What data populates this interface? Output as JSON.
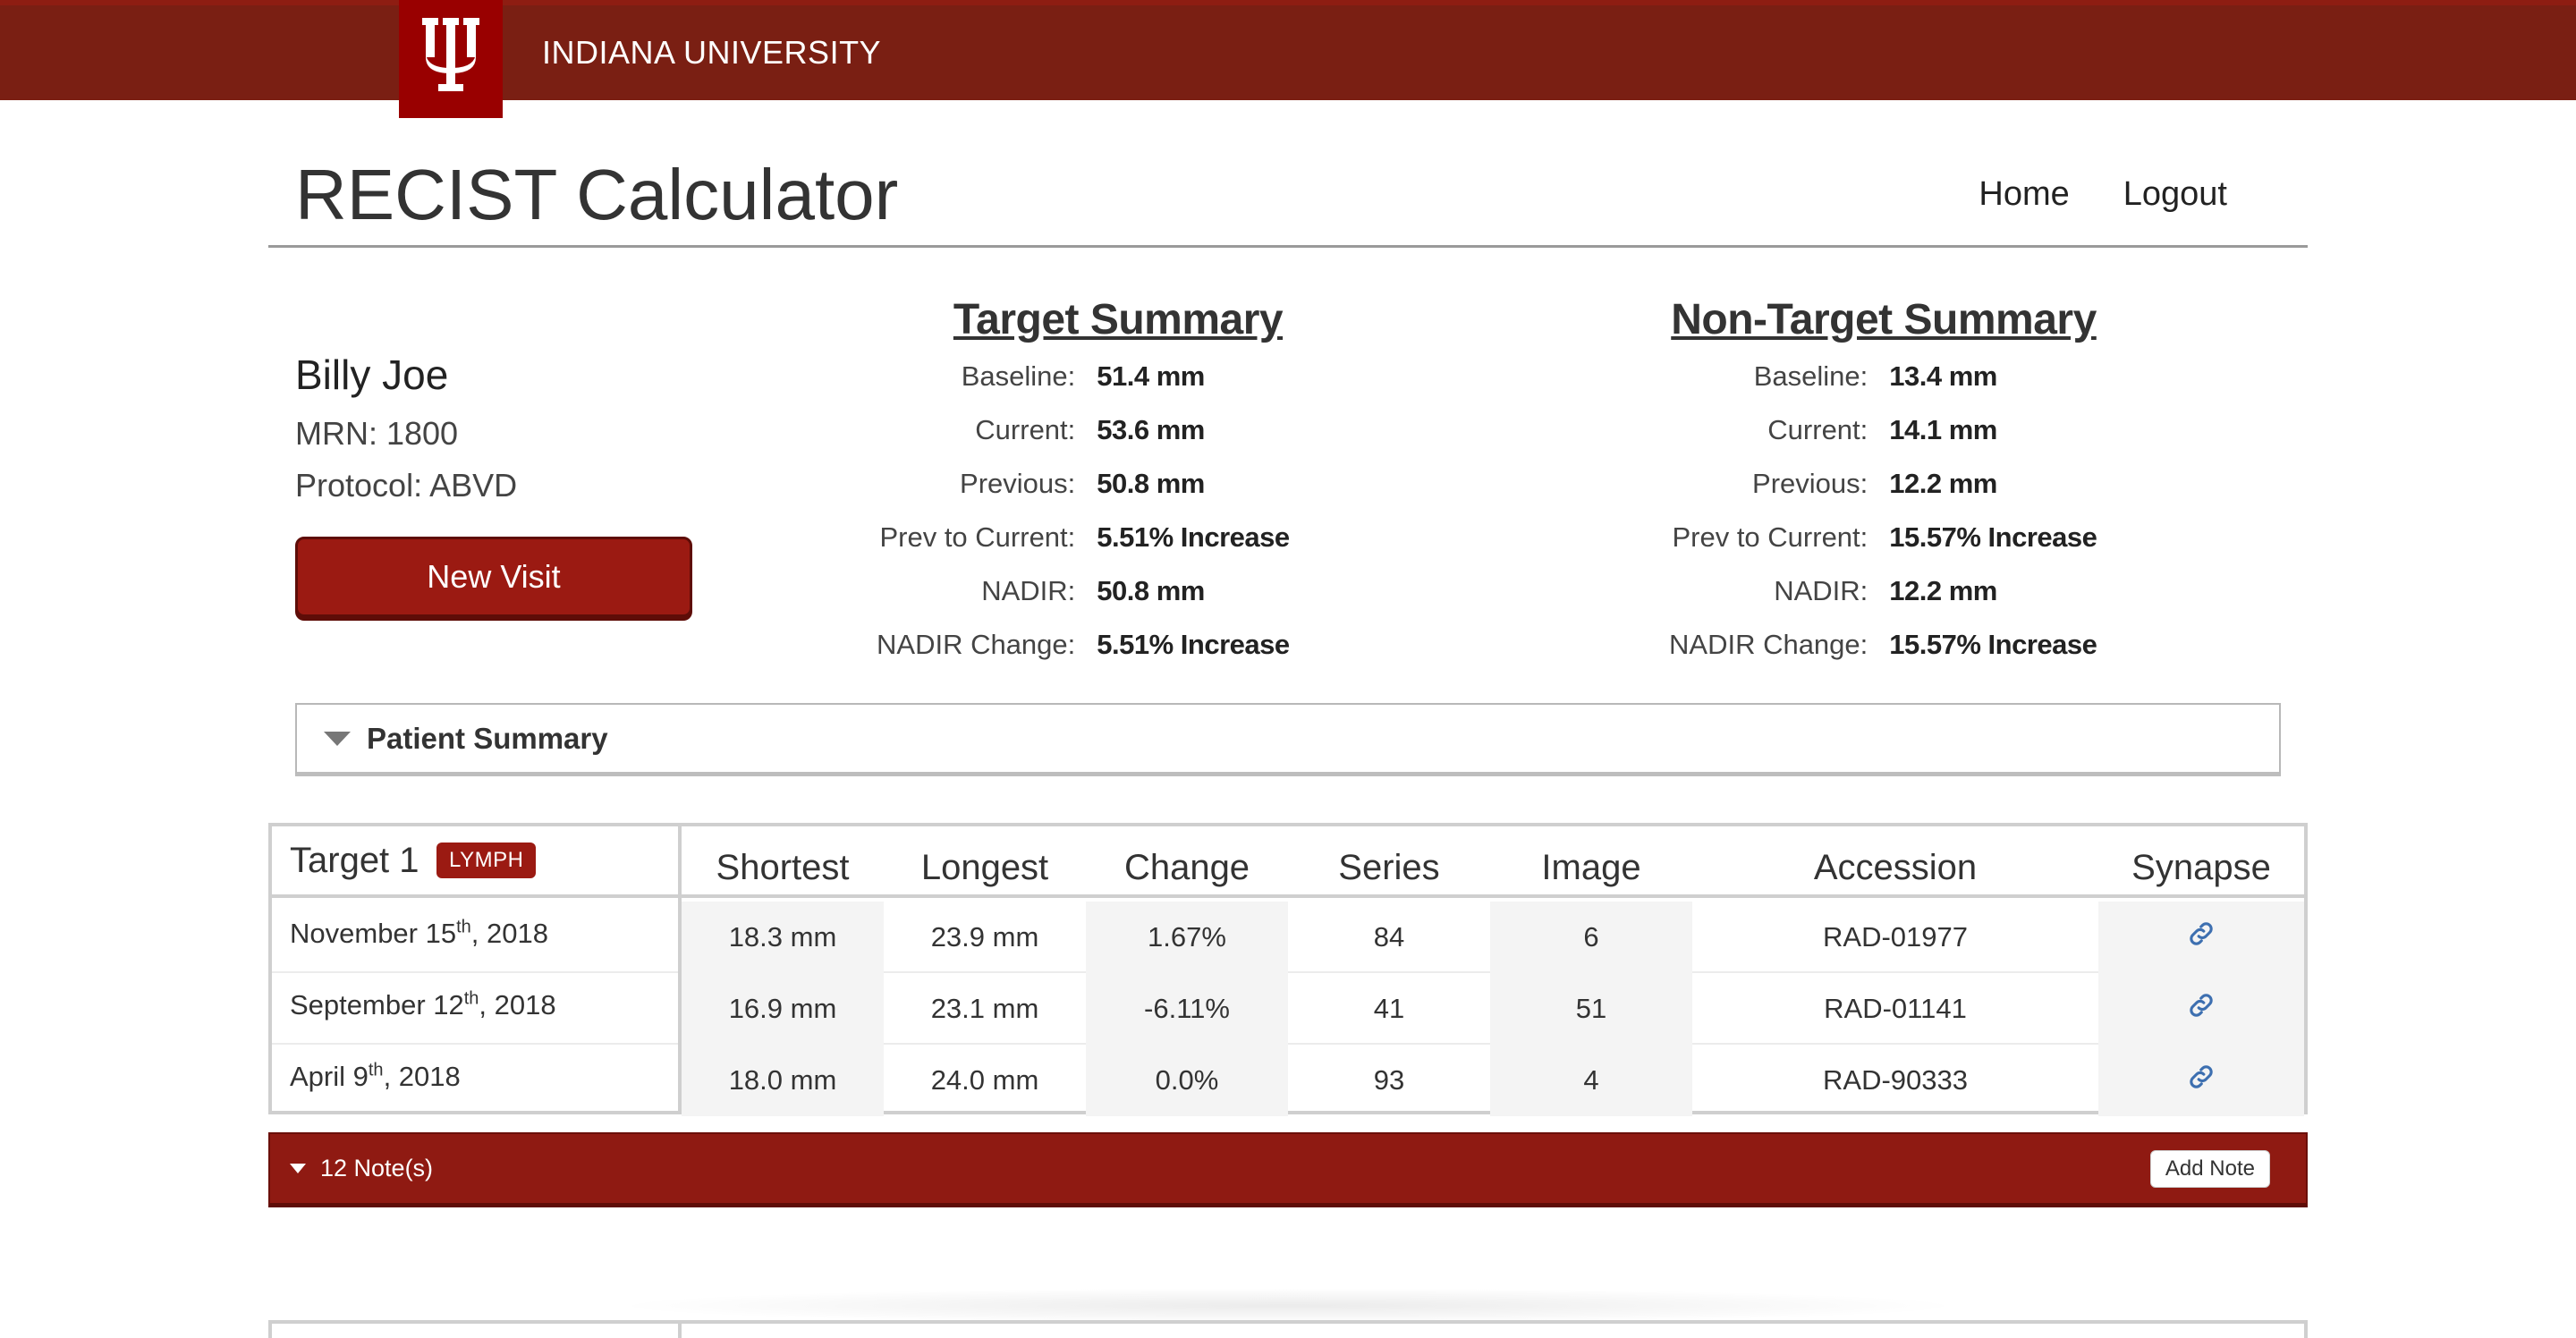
{
  "brand": {
    "university": "INDIANA UNIVERSITY",
    "logo_icon": "iu-trident-icon",
    "brand_color": "#990000",
    "bar_color": "#7a1f13"
  },
  "header": {
    "title": "RECIST Calculator",
    "nav": [
      {
        "label": "Home"
      },
      {
        "label": "Logout"
      }
    ]
  },
  "patient": {
    "name": "Billy Joe",
    "mrn": "MRN: 1800",
    "protocol": "Protocol: ABVD",
    "new_visit_label": "New Visit"
  },
  "target_summary": {
    "title": "Target Summary",
    "rows": [
      {
        "label": "Baseline:",
        "value": "51.4 mm"
      },
      {
        "label": "Current:",
        "value": "53.6 mm"
      },
      {
        "label": "Previous:",
        "value": "50.8 mm"
      },
      {
        "label": "Prev to Current:",
        "value": "5.51% Increase"
      },
      {
        "label": "NADIR:",
        "value": "50.8 mm"
      },
      {
        "label": "NADIR Change:",
        "value": "5.51% Increase"
      }
    ]
  },
  "non_target_summary": {
    "title": "Non-Target Summary",
    "rows": [
      {
        "label": "Baseline:",
        "value": "13.4 mm"
      },
      {
        "label": "Current:",
        "value": "14.1 mm"
      },
      {
        "label": "Previous:",
        "value": "12.2 mm"
      },
      {
        "label": "Prev to Current:",
        "value": "15.57% Increase"
      },
      {
        "label": "NADIR:",
        "value": "12.2 mm"
      },
      {
        "label": "NADIR Change:",
        "value": "15.57% Increase"
      }
    ]
  },
  "patient_summary": {
    "label": "Patient Summary"
  },
  "target_table": {
    "title": "Target 1",
    "badge": "LYMPH",
    "columns": [
      "Shortest",
      "Longest",
      "Change",
      "Series",
      "Image",
      "Accession",
      "Synapse"
    ],
    "rows": [
      {
        "date_pre": "November 15",
        "date_sup": "th",
        "date_post": ", 2018",
        "shortest": "18.3 mm",
        "longest": "23.9 mm",
        "change": "1.67%",
        "series": "84",
        "image": "6",
        "accession": "RAD-01977",
        "synapse_icon": "link-icon"
      },
      {
        "date_pre": "September 12",
        "date_sup": "th",
        "date_post": ", 2018",
        "shortest": "16.9 mm",
        "longest": "23.1 mm",
        "change": "-6.11%",
        "series": "41",
        "image": "51",
        "accession": "RAD-01141",
        "synapse_icon": "link-icon"
      },
      {
        "date_pre": "April 9",
        "date_sup": "th",
        "date_post": ", 2018",
        "shortest": "18.0 mm",
        "longest": "24.0 mm",
        "change": "0.0%",
        "series": "93",
        "image": "4",
        "accession": "RAD-90333",
        "synapse_icon": "link-icon"
      }
    ]
  },
  "notes": {
    "label": "12 Note(s)",
    "add_label": "Add Note"
  }
}
